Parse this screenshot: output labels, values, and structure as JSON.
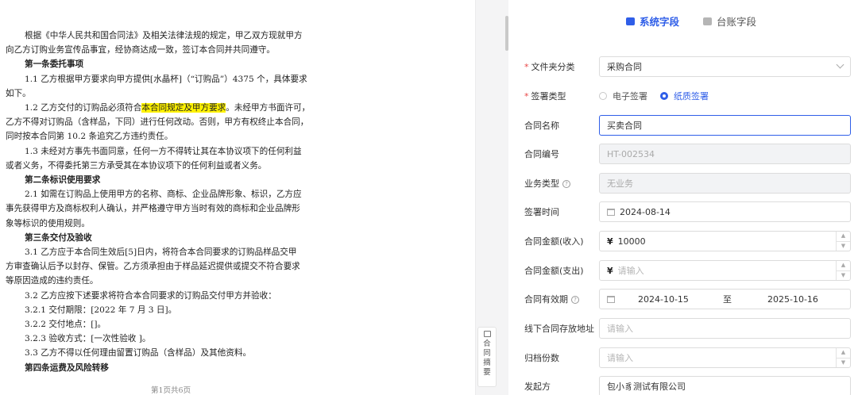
{
  "document": {
    "lines": [
      {
        "text": "根据《中华人民共和国合同法》及相关法律法规的规定，甲乙双方现就甲方",
        "style": "ind"
      },
      {
        "text": "向乙方订购业务宣传品事宜，经协商达成一致，签订本合同并共同遵守。",
        "style": ""
      },
      {
        "text": "第一条委托事项",
        "style": "ind bold"
      },
      {
        "text": "1.1 乙方根据甲方要求向甲方提供[水晶杯]（“订购品”）4375 个，具体要求",
        "style": "ind"
      },
      {
        "text": "如下。",
        "style": ""
      },
      {
        "pre": "1.2 乙方交付的订购品必须符合",
        "hl": "本合同规定及甲方要求",
        "post": "。未经甲方书面许可，",
        "style": "ind"
      },
      {
        "text": "乙方不得对订购品（含样品，下同）进行任何改动。否则，甲方有权终止本合同，",
        "style": ""
      },
      {
        "text": "同时按本合同第 10.2 条追究乙方违约责任。",
        "style": ""
      },
      {
        "text": "1.3 未经对方事先书面同意，任何一方不得转让其在本协议项下的任何利益",
        "style": "ind"
      },
      {
        "text": "或者义务，不得委托第三方承受其在本协议项下的任何利益或者义务。",
        "style": ""
      },
      {
        "text": "第二条标识使用要求",
        "style": "ind bold"
      },
      {
        "text": "2.1 如需在订购品上使用甲方的名称、商标、企业品牌形象、标识，乙方应",
        "style": "ind"
      },
      {
        "text": "事先获得甲方及商标权利人确认，并严格遵守甲方当时有效的商标和企业品牌形",
        "style": ""
      },
      {
        "text": "象等标识的使用规则。",
        "style": ""
      },
      {
        "text": "第三条交付及验收",
        "style": "ind bold"
      },
      {
        "text": "3.1 乙方应于本合同生效后[5]日内，将符合本合同要求的订购品样品交甲",
        "style": "ind"
      },
      {
        "text": "方审查确认后予以封存、保管。乙方须承担由于样品延迟提供或提交不符合要求",
        "style": ""
      },
      {
        "text": "等原因造成的违约责任。",
        "style": ""
      },
      {
        "text": "3.2 乙方应按下述要求将符合本合同要求的订购品交付甲方并验收：",
        "style": "ind"
      },
      {
        "text": "3.2.1 交付期限：[2022 年 7 月 3 日]。",
        "style": "ind"
      },
      {
        "text": "3.2.2 交付地点：[]。",
        "style": "ind"
      },
      {
        "text": "3.2.3 验收方式：[一次性验收 ]。",
        "style": "ind"
      },
      {
        "text": "3.3 乙方不得以任何理由留置订购品（含样品）及其他资料。",
        "style": "ind"
      },
      {
        "text": "第四条运费及风险转移",
        "style": "ind bold"
      }
    ],
    "footer": "第1页共6页"
  },
  "summary_tab": {
    "chars": [
      "合",
      "同",
      "摘",
      "要"
    ]
  },
  "tabs": {
    "system": "系统字段",
    "ledger": "台账字段"
  },
  "form": {
    "folder_category": {
      "label": "文件夹分类",
      "value": "采购合同"
    },
    "sign_type": {
      "label": "签署类型",
      "option_electronic": "电子签署",
      "option_paper": "纸质签署"
    },
    "contract_name": {
      "label": "合同名称",
      "value": "买卖合同"
    },
    "contract_no": {
      "label": "合同编号",
      "value": "HT-002534"
    },
    "business_type": {
      "label": "业务类型",
      "value": "无业务"
    },
    "sign_date": {
      "label": "签署时间",
      "value": "2024-08-14"
    },
    "amount_in": {
      "label": "合同金额(收入)",
      "currency": "¥",
      "value": "10000"
    },
    "amount_out": {
      "label": "合同金额(支出)",
      "currency": "¥",
      "placeholder": "请输入"
    },
    "validity": {
      "label": "合同有效期",
      "start": "2024-10-15",
      "separator": "至",
      "end": "2025-10-16"
    },
    "offline_address": {
      "label": "线下合同存放地址",
      "placeholder": "请输入"
    },
    "archive_copies": {
      "label": "归档份数",
      "placeholder": "请输入"
    },
    "initiator": {
      "label": "发起方",
      "value": "包小豸测试有限公司"
    }
  }
}
